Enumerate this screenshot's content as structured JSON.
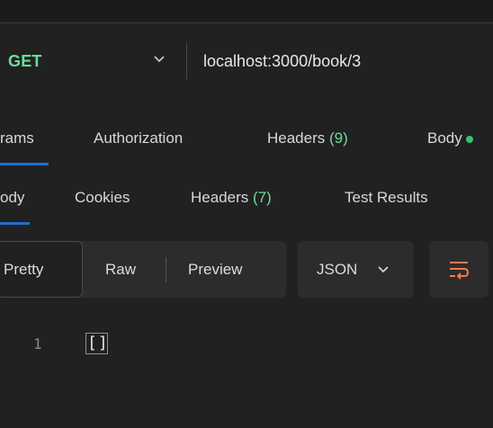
{
  "request": {
    "method": "GET",
    "url": "localhost:3000/book/3"
  },
  "request_tabs": [
    {
      "label": "rams",
      "count": ""
    },
    {
      "label": "Authorization",
      "count": ""
    },
    {
      "label": "Headers ",
      "count": "(9)"
    },
    {
      "label": "Body",
      "count": ""
    }
  ],
  "response_tabs": [
    {
      "label": "ody",
      "count": ""
    },
    {
      "label": "Cookies",
      "count": ""
    },
    {
      "label": "Headers ",
      "count": "(7)"
    },
    {
      "label": "Test Results",
      "count": ""
    }
  ],
  "view": {
    "modes": [
      "Pretty",
      "Raw",
      "Preview"
    ],
    "selected_mode": "Pretty",
    "format": "JSON"
  },
  "editor": {
    "lines": [
      {
        "number": "1",
        "text": "[]"
      }
    ]
  },
  "colors": {
    "method": "#6bdd9a",
    "accent": "#1f6fd1",
    "count": "#6bdd9a",
    "body_dot": "#3fbf6f",
    "wrap_icon": "#f07a4a"
  },
  "icons": [
    "chevron-down-icon",
    "chevron-down-icon",
    "wrap-lines-icon",
    "status-dot-icon"
  ]
}
